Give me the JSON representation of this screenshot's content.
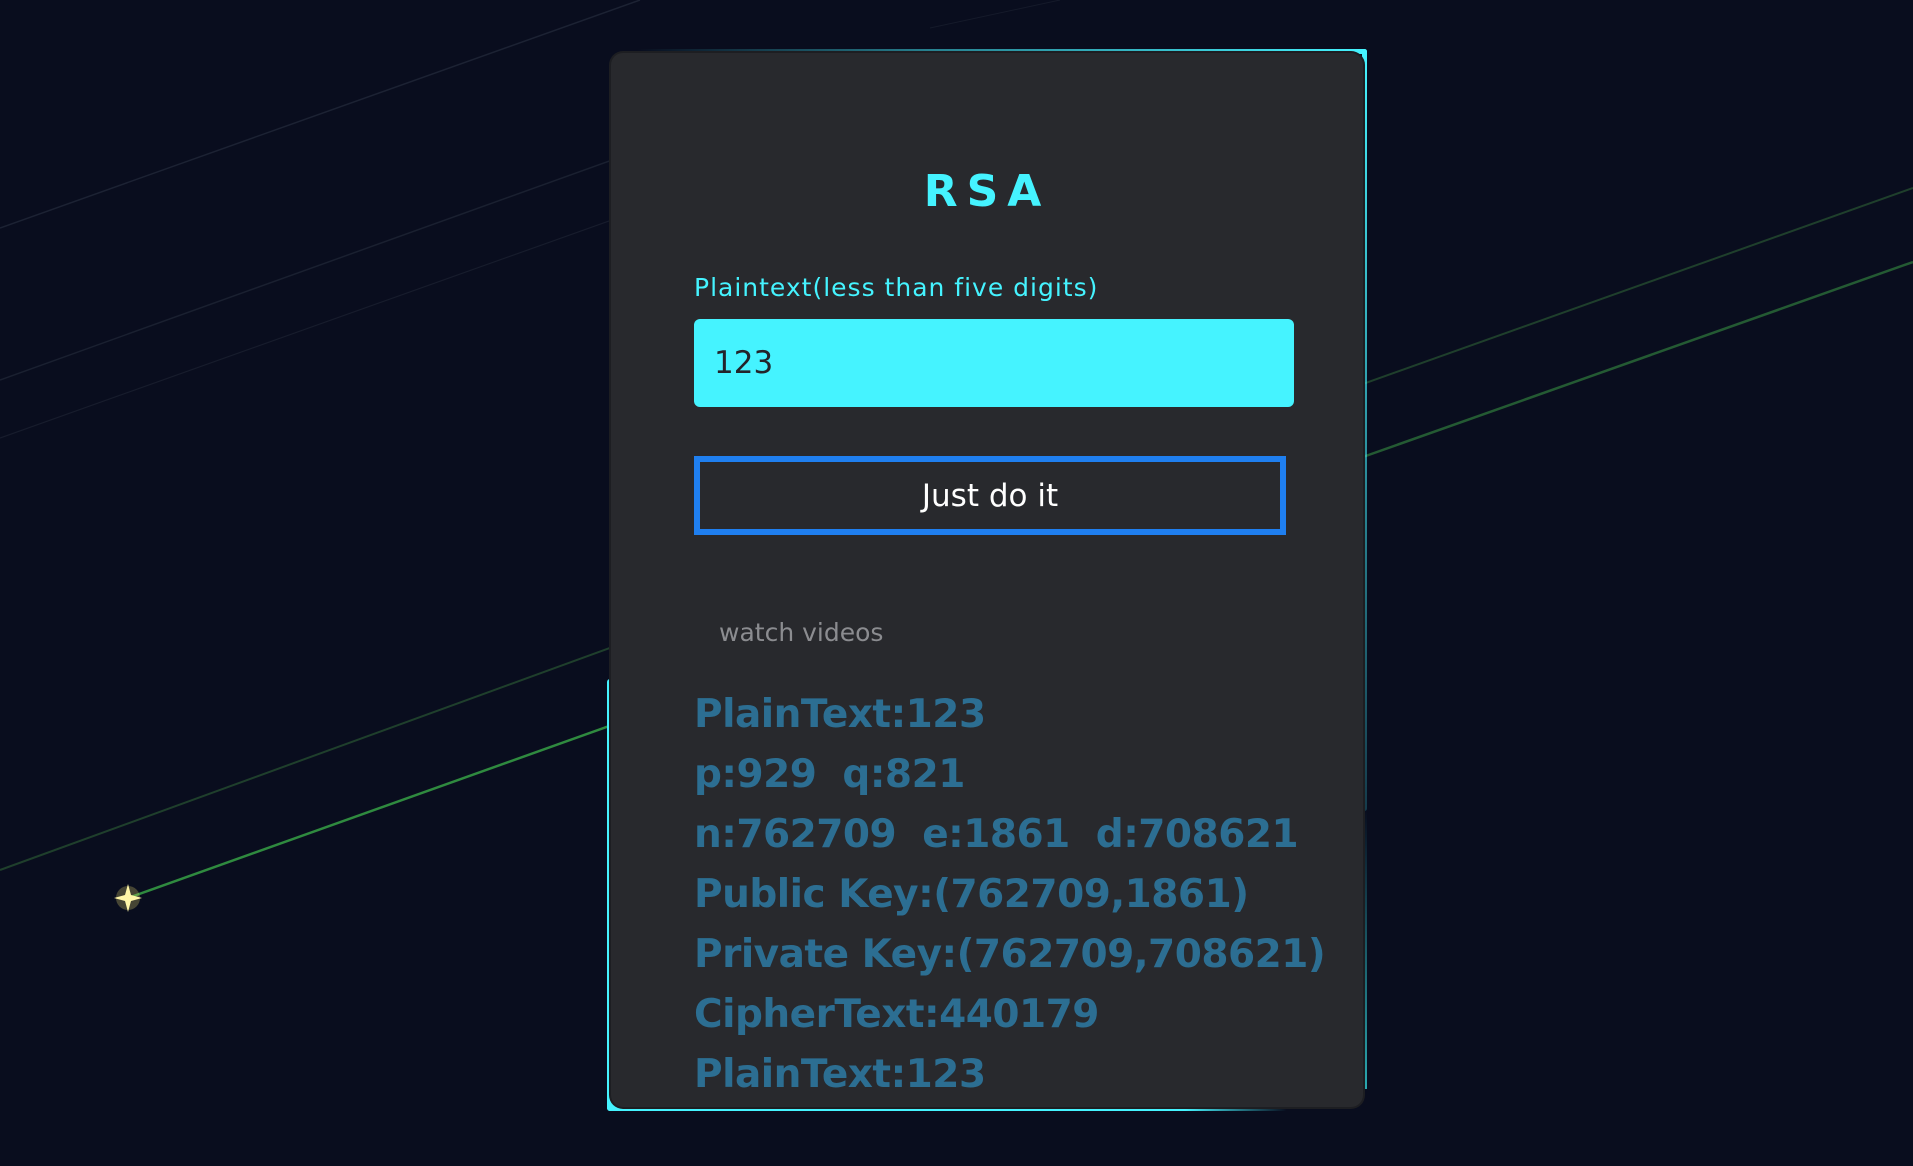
{
  "form": {
    "title": "RSA",
    "input_label": "Plaintext(less than five digits)",
    "input_value": "123",
    "button_label": "Just do it",
    "link_label": "watch videos"
  },
  "results": {
    "plaintext": "PlainText:123",
    "p": "p:929",
    "q": "q:821",
    "n": "n:762709",
    "e": "e:1861",
    "d": "d:708621",
    "public_key": "Public Key:(762709,1861)",
    "private_key": "Private Key:(762709,708621)",
    "ciphertext": "CipherText:440179",
    "decrypted": "PlainText:123"
  },
  "colors": {
    "accent": "#45f3ff",
    "card": "#28292d",
    "button_border": "#1f7ff0",
    "result_text": "#2c6e92",
    "background": "#090d1e"
  }
}
